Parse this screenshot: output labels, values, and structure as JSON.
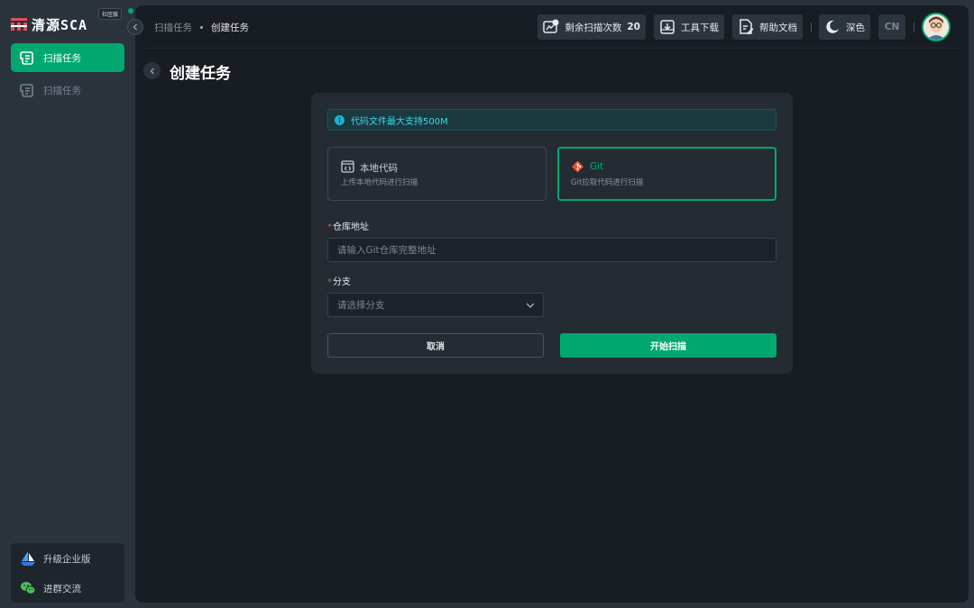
{
  "brand": {
    "name": "清源SCA",
    "edition_badge": "社区版"
  },
  "sidebar": {
    "items": [
      {
        "label": "扫描任务",
        "icon": "scroll-icon",
        "active": true
      },
      {
        "label": "扫描任务",
        "icon": "scroll-icon",
        "active": false
      }
    ],
    "bottom": [
      {
        "label": "升级企业版",
        "icon": "sailboat-icon"
      },
      {
        "label": "进群交流",
        "icon": "wechat-icon"
      }
    ]
  },
  "breadcrumb": {
    "parent": "扫描任务",
    "current": "创建任务"
  },
  "header": {
    "remaining_scans_label": "剩余扫描次数",
    "remaining_scans_count": "20",
    "tool_download": "工具下载",
    "help_docs": "帮助文档",
    "theme": "深色",
    "lang": "CN"
  },
  "page": {
    "title": "创建任务"
  },
  "form": {
    "notice": "代码文件最大支持500M",
    "source_options": [
      {
        "title": "本地代码",
        "desc": "上传本地代码进行扫描",
        "icon": "code-window-icon",
        "selected": false
      },
      {
        "title": "Git",
        "desc": "Git拉取代码进行扫描",
        "icon": "git-icon",
        "selected": true
      }
    ],
    "repo_label": "仓库地址",
    "repo_placeholder": "请输入Git仓库完整地址",
    "repo_value": "",
    "branch_label": "分支",
    "branch_placeholder": "请选择分支",
    "required_mark": "*",
    "cancel_label": "取消",
    "start_label": "开始扫描"
  },
  "colors": {
    "accent": "#00a870",
    "info": "#3fd5e8",
    "required": "#e34d59",
    "git": "#f05133"
  }
}
